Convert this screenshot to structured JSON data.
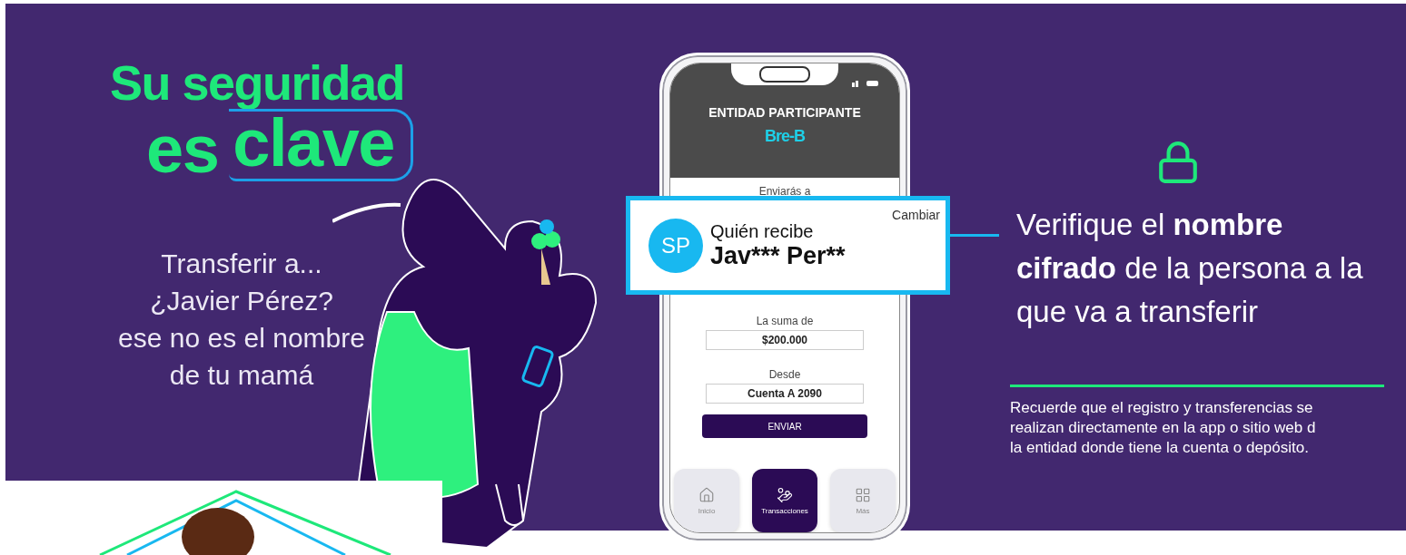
{
  "headline": {
    "line_1": "Su seguridad",
    "line_2_lead": "es",
    "line_2_key": "clave"
  },
  "speech": "Transferir a...\n¿Javier Pérez?\nese no es el nombre\nde tu mamá",
  "phone": {
    "header_title": "ENTIDAD PARTICIPANTE",
    "brand": "Bre-B",
    "send_to_label": "Enviarás a",
    "recipient": {
      "initials": "SP",
      "label": "Quién recibe",
      "name": "Jav*** Per**",
      "change": "Cambiar"
    },
    "amount_label": "La suma de",
    "amount": "$200.000",
    "from_label": "Desde",
    "from_value": "Cuenta A 2090",
    "button": "ENVIAR",
    "tabs": [
      {
        "kind": "home",
        "label": "Inicio",
        "selected": false
      },
      {
        "kind": "transactions",
        "label": "Transacciones",
        "selected": true
      },
      {
        "kind": "more",
        "label": "Más",
        "selected": false
      }
    ]
  },
  "message": "Verifique el **nombre cifrado** de la persona a la que va a transferir",
  "note": "Recuerde que el registro y transferencias se\nrealizan directamente en la app o sitio web d\nla entidad donde tiene la cuenta o depósito."
}
